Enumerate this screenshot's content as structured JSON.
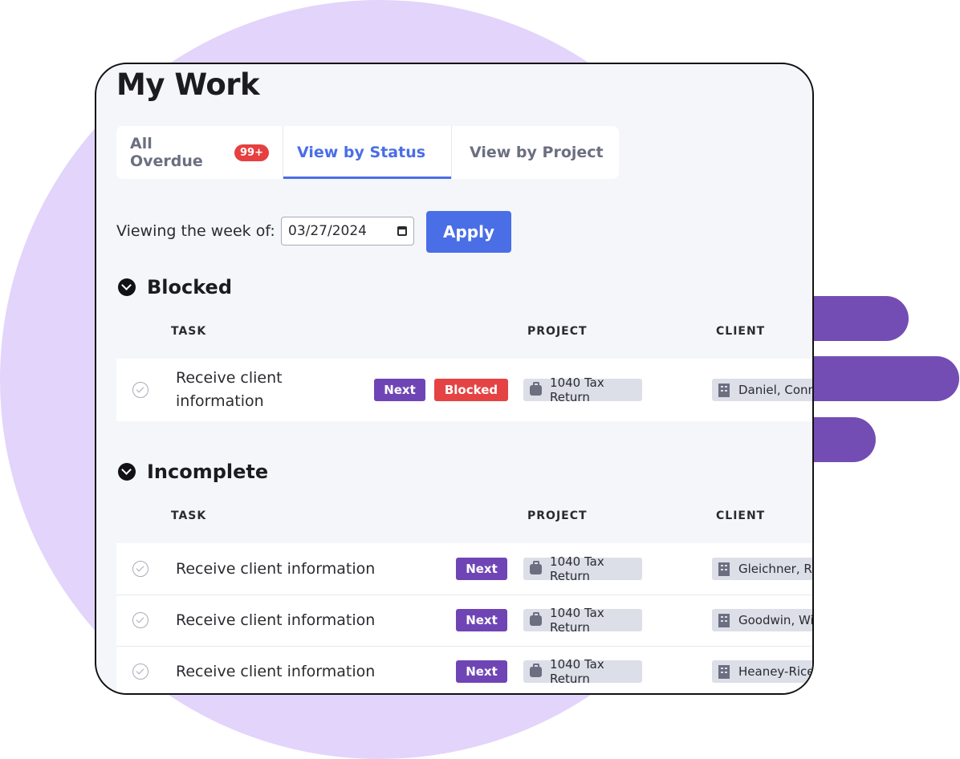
{
  "page": {
    "title": "My Work"
  },
  "tabs": [
    {
      "label": "All Overdue",
      "badge": "99+"
    },
    {
      "label": "View by Status"
    },
    {
      "label": "View by Project"
    }
  ],
  "filter": {
    "label": "Viewing the week of:",
    "date": "03/27/2024",
    "apply_label": "Apply"
  },
  "columns": {
    "task": "TASK",
    "project": "PROJECT",
    "client": "CLIENT"
  },
  "sections": [
    {
      "title": "Blocked",
      "rows": [
        {
          "task_line1": "Receive client",
          "task_line2": "information",
          "tags": [
            "Next",
            "Blocked"
          ],
          "project": "1040 Tax Return",
          "client": "Daniel, Conne"
        }
      ]
    },
    {
      "title": "Incomplete",
      "rows": [
        {
          "task": "Receive client information",
          "tag": "Next",
          "project": "1040 Tax Return",
          "client": "Gleichner, Rit"
        },
        {
          "task": "Receive client information",
          "tag": "Next",
          "project": "1040 Tax Return",
          "client": "Goodwin, Wil"
        },
        {
          "task": "Receive client information",
          "tag": "Next",
          "project": "1040 Tax Return",
          "client": "Heaney-Rice"
        }
      ]
    }
  ],
  "colors": {
    "accent": "#4a6ee6",
    "next": "#6f45b6",
    "blocked": "#e54343",
    "decor_circle": "#e2d4fb",
    "decor_bars": "#734db3"
  }
}
